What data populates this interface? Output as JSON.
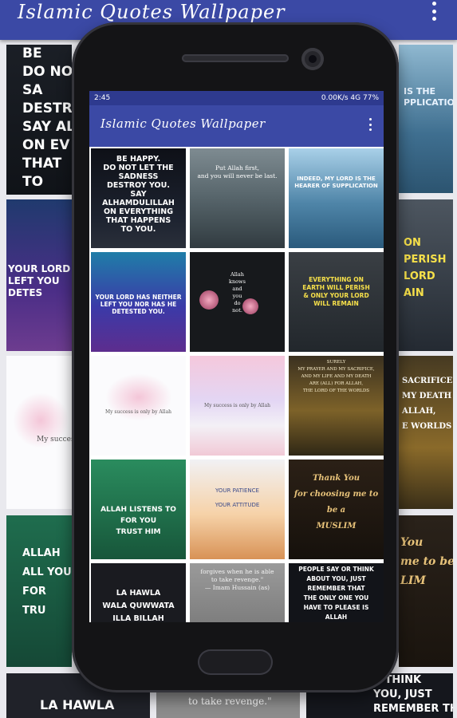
{
  "app": {
    "title": "Islamic Quotes Wallpaper",
    "menu_icon": "kebab-menu-icon"
  },
  "phone": {
    "status": {
      "time": "2:45",
      "right": "0.00K/s  4G  77%"
    },
    "title": "Islamic Quotes Wallpaper",
    "menu_icon": "kebab-menu-icon"
  },
  "tiles": [
    {
      "caption": "BE HAPPY.\nDO NOT LET THE\nSADNESS\nDESTROY YOU.\nSAY ALHAMDULILLAH\nON EVERYTHING\nTHAT HAPPENS\nTO YOU."
    },
    {
      "caption": "Put Allah first,\nand you will never be last."
    },
    {
      "caption": "INDEED, MY LORD IS THE\nHEARER OF SUPPLICATION"
    },
    {
      "caption": "YOUR LORD HAS NEITHER\nLEFT YOU NOR HAS HE\nDETESTED YOU."
    },
    {
      "caption": "Allah\nknows\nand\nyou\ndo\nnot."
    },
    {
      "caption": "EVERYTHING ON\nEARTH WILL PERISH\n& ONLY YOUR LORD\nWILL REMAIN"
    },
    {
      "caption": "My success is only by Allah"
    },
    {
      "caption": "My success is only by Allah"
    },
    {
      "caption": "SURELY\nMY PRAYER AND MY SACRIFICE,\nAND MY LIFE AND MY DEATH\nARE (ALL) FOR ALLAH,\nTHE LORD OF THE WORLDS"
    },
    {
      "caption": "ALLAH LISTENS TO\nFOR YOU\nTRUST HIM"
    },
    {
      "caption": "YOUR PATIENCE\nYOUR ATTITUDE"
    },
    {
      "caption": "Thank You\nfor choosing me to be a\nMUSLIM"
    },
    {
      "caption": "LA HAWLA\nWALA QUWWATA\nILLA BILLAH"
    },
    {
      "caption": "forgives when he is able\nto take revenge.\"\n— Imam Hussain (as)"
    },
    {
      "caption": "PEOPLE SAY OR THINK\nABOUT YOU, JUST\nREMEMBER THAT\nTHE ONLY ONE YOU\nHAVE TO PLEASE IS\nALLAH"
    }
  ],
  "background_captions": [
    "BE\nDO NO\nSA\nDESTR\nSAY ALH\nON EV\nTHAT\nTO",
    "YOUR LORD\nLEFT YOU\nDETES",
    "My success",
    "ALLAH\nALL YOUR SPOKEN\nFOR\nTRU",
    "LA HAWLA",
    "IS THE\nPPLICATION",
    "ON\nPERISH\nLORD\nAIN",
    "SACRIFICE\nMY DEATH\nALLAH,\nE WORLDS",
    "You\nme to be a\nLIM",
    "to take revenge.\"",
    "R THINK\nYOU, JUST\nREMEMBER THAT"
  ]
}
